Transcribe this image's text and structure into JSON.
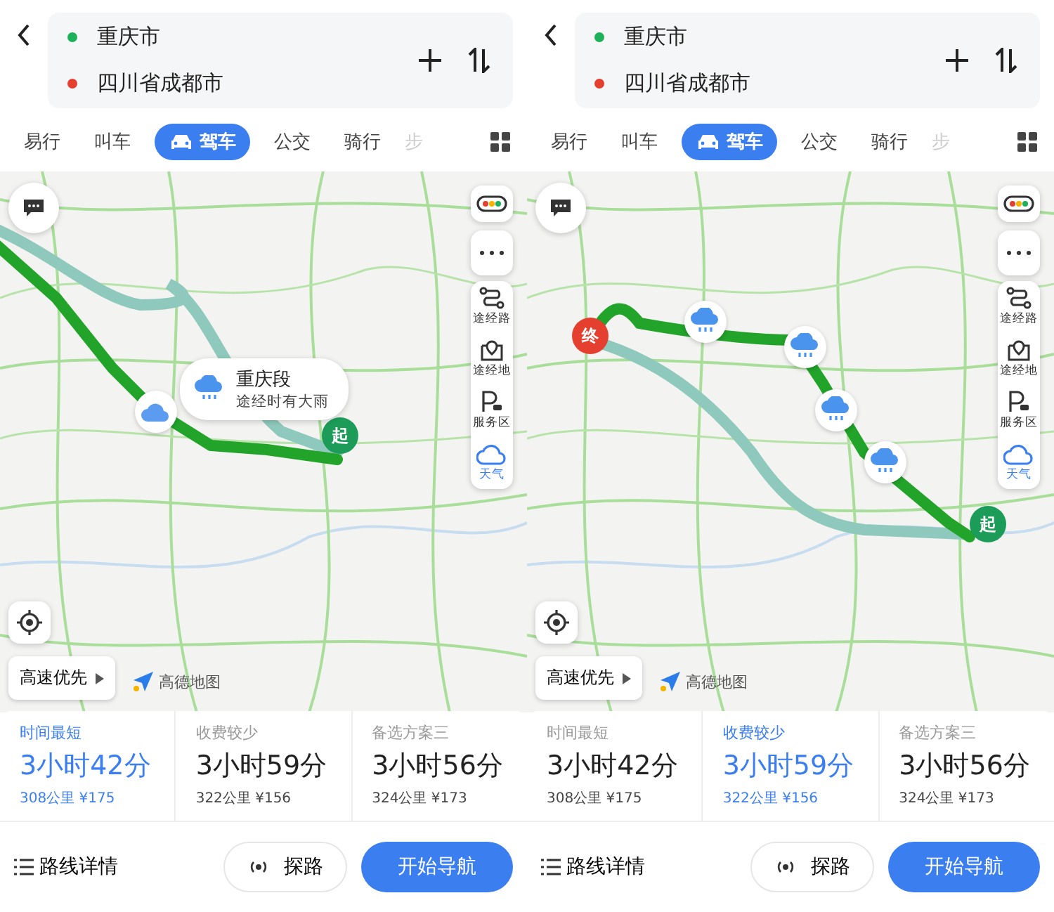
{
  "screens": [
    {
      "points": [
        {
          "name": "重庆市",
          "color": "#1db25a"
        },
        {
          "name": "四川省成都市",
          "color": "#e5402f"
        }
      ],
      "tabs": [
        {
          "label": "易行",
          "selected": false
        },
        {
          "label": "叫车",
          "selected": false
        },
        {
          "label": "驾车",
          "selected": true
        },
        {
          "label": "公交",
          "selected": false
        },
        {
          "label": "骑行",
          "selected": false
        },
        {
          "label": "步",
          "selected": false
        }
      ],
      "map": {
        "side_tools": [
          {
            "kind": "traffic"
          },
          {
            "kind": "more"
          },
          {
            "kind": "waypoint-road",
            "label": "途经路",
            "selected": false
          },
          {
            "kind": "waypoint-place",
            "label": "途经地",
            "selected": false
          },
          {
            "kind": "service",
            "label": "服务区",
            "selected": false
          },
          {
            "kind": "weather",
            "label": "天气",
            "selected": true
          }
        ],
        "markers": [
          {
            "kind": "cloud"
          },
          {
            "kind": "start",
            "label": "起"
          }
        ],
        "weather_bubble": {
          "title": "重庆段",
          "subtitle": "途经时有大雨"
        },
        "preference": "高速优先",
        "logo": "高德地图"
      },
      "routes": [
        {
          "label": "时间最短",
          "time": "3小时42分",
          "detail": "308公里 ¥175",
          "selected": true
        },
        {
          "label": "收费较少",
          "time": "3小时59分",
          "detail": "322公里 ¥156",
          "selected": false
        },
        {
          "label": "备选方案三",
          "time": "3小时56分",
          "detail": "324公里 ¥173",
          "selected": false
        }
      ],
      "details_link": "路线详情",
      "explore_button": "探路",
      "navigate_button": "开始导航"
    },
    {
      "points": [
        {
          "name": "重庆市",
          "color": "#1db25a"
        },
        {
          "name": "四川省成都市",
          "color": "#e5402f"
        }
      ],
      "tabs": [
        {
          "label": "易行",
          "selected": false
        },
        {
          "label": "叫车",
          "selected": false
        },
        {
          "label": "驾车",
          "selected": true
        },
        {
          "label": "公交",
          "selected": false
        },
        {
          "label": "骑行",
          "selected": false
        },
        {
          "label": "步",
          "selected": false
        }
      ],
      "map": {
        "side_tools": [
          {
            "kind": "traffic"
          },
          {
            "kind": "more"
          },
          {
            "kind": "waypoint-road",
            "label": "途经路",
            "selected": false
          },
          {
            "kind": "waypoint-place",
            "label": "途经地",
            "selected": false
          },
          {
            "kind": "service",
            "label": "服务区",
            "selected": false
          },
          {
            "kind": "weather",
            "label": "天气",
            "selected": true
          }
        ],
        "markers": [
          {
            "kind": "end",
            "label": "终"
          },
          {
            "kind": "rain"
          },
          {
            "kind": "rain"
          },
          {
            "kind": "rain"
          },
          {
            "kind": "rain"
          },
          {
            "kind": "start",
            "label": "起"
          }
        ],
        "preference": "高速优先",
        "logo": "高德地图"
      },
      "routes": [
        {
          "label": "时间最短",
          "time": "3小时42分",
          "detail": "308公里 ¥175",
          "selected": false
        },
        {
          "label": "收费较少",
          "time": "3小时59分",
          "detail": "322公里 ¥156",
          "selected": true
        },
        {
          "label": "备选方案三",
          "time": "3小时56分",
          "detail": "324公里 ¥173",
          "selected": false
        }
      ],
      "details_link": "路线详情",
      "explore_button": "探路",
      "navigate_button": "开始导航"
    }
  ]
}
